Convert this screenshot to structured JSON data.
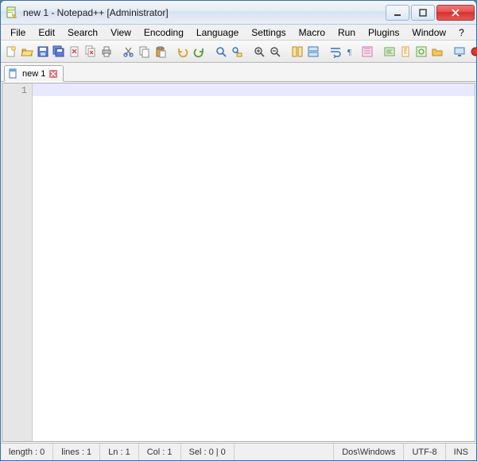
{
  "window": {
    "title": "new 1 - Notepad++ [Administrator]"
  },
  "menubar": {
    "items": [
      "File",
      "Edit",
      "Search",
      "View",
      "Encoding",
      "Language",
      "Settings",
      "Macro",
      "Run",
      "Plugins",
      "Window",
      "?"
    ],
    "close_x": "X"
  },
  "toolbar": {
    "icons": [
      "new-file-icon",
      "open-file-icon",
      "save-icon",
      "save-all-icon",
      "close-icon",
      "close-all-icon",
      "print-icon",
      "sep",
      "cut-icon",
      "copy-icon",
      "paste-icon",
      "sep",
      "undo-icon",
      "redo-icon",
      "sep",
      "find-icon",
      "replace-icon",
      "sep",
      "zoom-in-icon",
      "zoom-out-icon",
      "sep",
      "sync-v-icon",
      "sync-h-icon",
      "sep",
      "word-wrap-icon",
      "all-chars-icon",
      "indent-guide-icon",
      "sep",
      "language-icon",
      "doc-map-icon",
      "eye-icon",
      "folder-icon",
      "sep",
      "record-macro-icon",
      "play-macro-icon"
    ]
  },
  "tabs": {
    "items": [
      {
        "label": "new 1",
        "dirty": false
      }
    ]
  },
  "editor": {
    "line_numbers": [
      "1"
    ],
    "current_line": 1,
    "content": [
      ""
    ]
  },
  "statusbar": {
    "length": "length : 0",
    "lines": "lines : 1",
    "ln": "Ln : 1",
    "col": "Col : 1",
    "sel": "Sel : 0 | 0",
    "eol": "Dos\\Windows",
    "encoding": "UTF-8",
    "insert_mode": "INS"
  }
}
